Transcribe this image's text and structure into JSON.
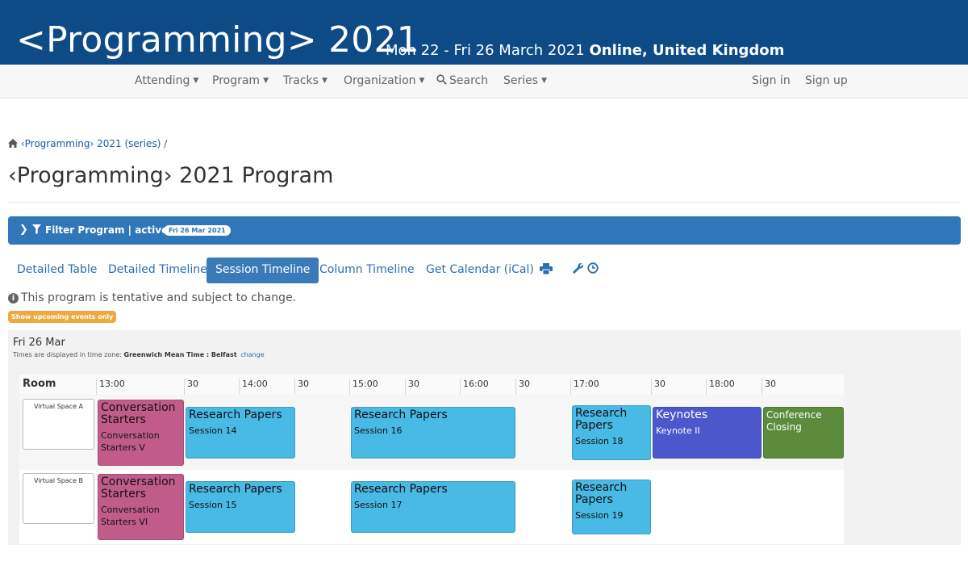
{
  "header": {
    "title": "<Programming> 2021",
    "dates": "Mon 22 - Fri 26 March 2021",
    "location": "Online, United Kingdom"
  },
  "nav": {
    "attending": "Attending",
    "program": "Program",
    "tracks": "Tracks",
    "organization": "Organization",
    "search": "Search",
    "series": "Series",
    "sign_in": "Sign in",
    "sign_up": "Sign up"
  },
  "breadcrumb": {
    "link": "‹Programming› 2021 (series)",
    "sep": "/"
  },
  "page_title": "‹Programming› 2021 Program",
  "filter": {
    "label": "Filter Program | active:",
    "badge": "Fri 26 Mar 2021"
  },
  "tabs": {
    "detailed_table": "Detailed Table",
    "detailed_timeline": "Detailed Timeline",
    "session_timeline": "Session Timeline",
    "column_timeline": "Column Timeline",
    "calendar": "Get Calendar (iCal)"
  },
  "notice": "This program is tentative and subject to change.",
  "upcoming_button": "Show upcoming events only",
  "timeline": {
    "day": "Fri 26 Mar",
    "tz_prefix": "Times are displayed in time zone:",
    "tz_name": "Greenwich Mean Time : Belfast",
    "tz_change": "change",
    "room_header": "Room",
    "ticks": [
      "13:00",
      "30",
      "14:00",
      "30",
      "15:00",
      "30",
      "16:00",
      "30",
      "17:00",
      "30",
      "18:00",
      "30"
    ],
    "rooms": [
      {
        "name": "Virtual Space A",
        "sessions": [
          {
            "title": "Conversation Starters",
            "sub": "Conversation Starters V"
          },
          {
            "title": "Research Papers",
            "sub": "Session 14"
          },
          {
            "title": "Research Papers",
            "sub": "Session 16"
          },
          {
            "title": "Research Papers",
            "sub": "Session 18"
          },
          {
            "title": "Keynotes",
            "sub": "Keynote II"
          },
          {
            "title": "Conference Closing",
            "sub": ""
          }
        ]
      },
      {
        "name": "Virtual Space B",
        "sessions": [
          {
            "title": "Conversation Starters",
            "sub": "Conversation Starters VI"
          },
          {
            "title": "Research Papers",
            "sub": "Session 15"
          },
          {
            "title": "Research Papers",
            "sub": "Session 17"
          },
          {
            "title": "Research Papers",
            "sub": "Session 19"
          }
        ]
      }
    ]
  },
  "colors": {
    "header_bg": "#0d4a86",
    "filter_bar": "#3176b8",
    "research": "#49b9e6",
    "conversation": "#c15c8a",
    "keynote": "#4c57cc",
    "closing": "#5c8b3c",
    "upcoming_button": "#f0a840"
  }
}
